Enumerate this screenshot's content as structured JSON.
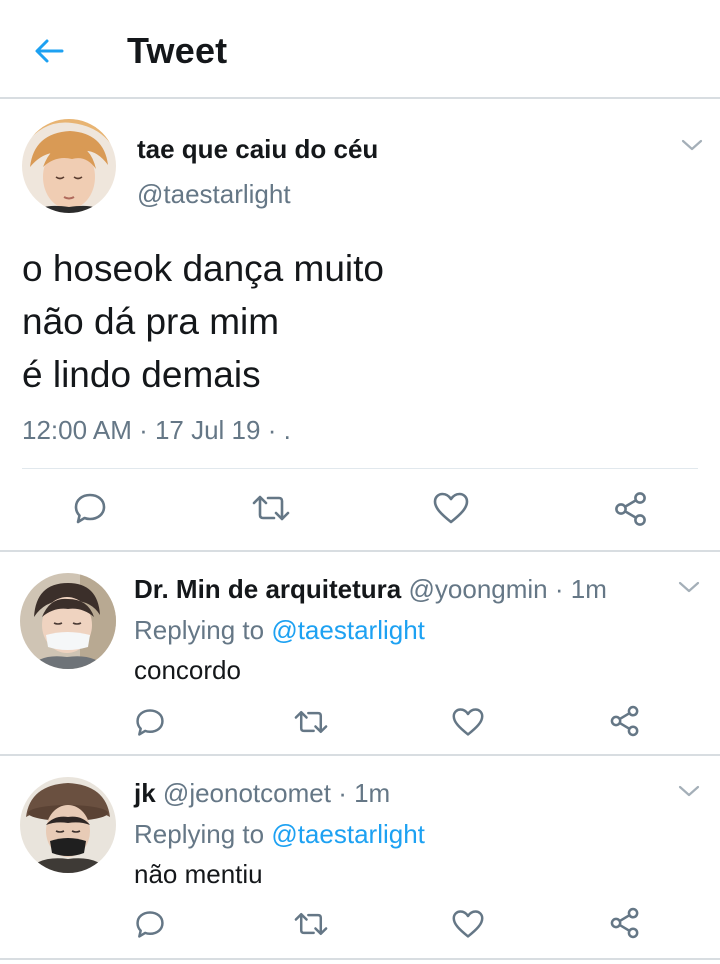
{
  "header": {
    "title": "Tweet",
    "back_icon": "arrow-left-icon",
    "accent_color": "#1da1f2"
  },
  "main_tweet": {
    "display_name": "tae que caiu do céu",
    "handle": "@taestarlight",
    "text_lines": [
      "o hoseok dança muito",
      "não dá pra mim",
      "é lindo demais"
    ],
    "meta": "12:00 AM · 17 Jul 19 · .",
    "actions": [
      "reply-icon",
      "retweet-icon",
      "like-icon",
      "share-icon"
    ]
  },
  "replies": [
    {
      "display_name": "Dr. Min de arquitetura",
      "handle": "@yoongmin",
      "time": "· 1m",
      "replying_label": "Replying to",
      "replying_handle": "@taestarlight",
      "text": "concordo"
    },
    {
      "display_name": "jk",
      "handle": "@jeonotcomet",
      "time": "· 1m",
      "replying_label": "Replying to",
      "replying_handle": "@taestarlight",
      "text": "não mentiu"
    }
  ],
  "colors": {
    "text": "#14171a",
    "secondary": "#657786",
    "link": "#1da1f2",
    "divider": "#d8dde1"
  }
}
